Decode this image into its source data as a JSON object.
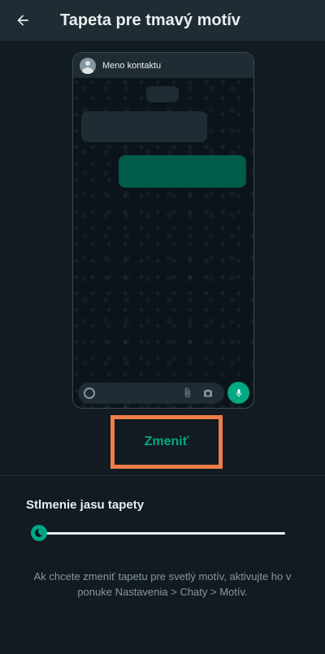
{
  "appbar": {
    "title": "Tapeta pre tmavý motív",
    "back_icon": "arrow-left-icon"
  },
  "preview": {
    "contact_name": "Meno kontaktu",
    "icons": [
      "avatar-icon",
      "emoji-icon",
      "paperclip-icon",
      "camera-icon",
      "mic-icon"
    ]
  },
  "change_button": {
    "label": "Zmeniť"
  },
  "dimming": {
    "title": "Stlmenie jasu tapety",
    "slider_value": 0
  },
  "info": {
    "text": "Ak chcete zmeniť tapetu pre svetlý motív, aktivujte ho v ponuke Nastavenia > Chaty > Motív."
  },
  "colors": {
    "background": "#121b22",
    "appbar": "#1f2c34",
    "accent": "#00a884",
    "outgoing_bubble": "#005c4b",
    "highlight_border": "#ef7d47",
    "secondary_text": "#8696a0"
  }
}
